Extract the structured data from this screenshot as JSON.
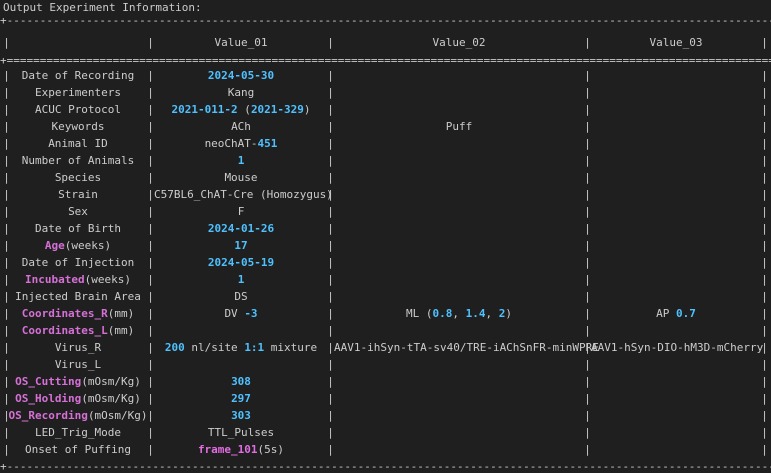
{
  "title": "Output Experiment Information:",
  "border_char": "-",
  "header": {
    "col0": "",
    "col1": "Value_01",
    "col2": "Value_02",
    "col3": "Value_03"
  },
  "colors": {
    "number": "#4fc1ff",
    "highlight": "#d670d6",
    "text": "#cccccc",
    "background": "#1f1f1f"
  },
  "rows": [
    {
      "label": [
        {
          "t": "Date of Recording"
        }
      ],
      "v1": [
        {
          "t": "2024-05-30",
          "c": "num"
        }
      ],
      "v2": [],
      "v3": []
    },
    {
      "label": [
        {
          "t": "Experimenters"
        }
      ],
      "v1": [
        {
          "t": "Kang"
        }
      ],
      "v2": [],
      "v3": []
    },
    {
      "label": [
        {
          "t": "ACUC Protocol"
        }
      ],
      "v1": [
        {
          "t": "2021-011-2",
          "c": "num"
        },
        {
          "t": " ("
        },
        {
          "t": "2021-329",
          "c": "num"
        },
        {
          "t": ")"
        }
      ],
      "v2": [],
      "v3": []
    },
    {
      "label": [
        {
          "t": "Keywords"
        }
      ],
      "v1": [
        {
          "t": "ACh"
        }
      ],
      "v2": [
        {
          "t": "Puff"
        }
      ],
      "v3": []
    },
    {
      "label": [
        {
          "t": "Animal ID"
        }
      ],
      "v1": [
        {
          "t": "neoChAT-"
        },
        {
          "t": "451",
          "c": "num"
        }
      ],
      "v2": [],
      "v3": []
    },
    {
      "label": [
        {
          "t": "Number of Animals"
        }
      ],
      "v1": [
        {
          "t": "1",
          "c": "num"
        }
      ],
      "v2": [],
      "v3": []
    },
    {
      "label": [
        {
          "t": "Species"
        }
      ],
      "v1": [
        {
          "t": "Mouse"
        }
      ],
      "v2": [],
      "v3": []
    },
    {
      "label": [
        {
          "t": "Strain"
        }
      ],
      "v1": [
        {
          "t": "C57BL6_ChAT-Cre (Homozygus)"
        }
      ],
      "v2": [],
      "v3": []
    },
    {
      "label": [
        {
          "t": "Sex"
        }
      ],
      "v1": [
        {
          "t": "F"
        }
      ],
      "v2": [],
      "v3": []
    },
    {
      "label": [
        {
          "t": "Date of Birth"
        }
      ],
      "v1": [
        {
          "t": "2024-01-26",
          "c": "num"
        }
      ],
      "v2": [],
      "v3": []
    },
    {
      "label": [
        {
          "t": "Age",
          "c": "mag"
        },
        {
          "t": "(weeks)"
        }
      ],
      "v1": [
        {
          "t": "17",
          "c": "num"
        }
      ],
      "v2": [],
      "v3": []
    },
    {
      "label": [
        {
          "t": "Date of Injection"
        }
      ],
      "v1": [
        {
          "t": "2024-05-19",
          "c": "num"
        }
      ],
      "v2": [],
      "v3": []
    },
    {
      "label": [
        {
          "t": "Incubated",
          "c": "mag"
        },
        {
          "t": "(weeks)"
        }
      ],
      "v1": [
        {
          "t": "1",
          "c": "num"
        }
      ],
      "v2": [],
      "v3": []
    },
    {
      "label": [
        {
          "t": "Injected Brain Area"
        }
      ],
      "v1": [
        {
          "t": "DS"
        }
      ],
      "v2": [],
      "v3": []
    },
    {
      "label": [
        {
          "t": "Coordinates_R",
          "c": "mag"
        },
        {
          "t": "(mm)"
        }
      ],
      "v1": [
        {
          "t": "DV "
        },
        {
          "t": "-3",
          "c": "num"
        }
      ],
      "v2": [
        {
          "t": "ML ("
        },
        {
          "t": "0.8",
          "c": "num"
        },
        {
          "t": ", "
        },
        {
          "t": "1.4",
          "c": "num"
        },
        {
          "t": ", "
        },
        {
          "t": "2",
          "c": "num"
        },
        {
          "t": ")"
        }
      ],
      "v3": [
        {
          "t": "AP "
        },
        {
          "t": "0.7",
          "c": "num"
        }
      ]
    },
    {
      "label": [
        {
          "t": "Coordinates_L",
          "c": "mag"
        },
        {
          "t": "(mm)"
        }
      ],
      "v1": [],
      "v2": [],
      "v3": []
    },
    {
      "label": [
        {
          "t": "Virus_R"
        }
      ],
      "v1": [
        {
          "t": "200",
          "c": "num"
        },
        {
          "t": " nl/site "
        },
        {
          "t": "1:1",
          "c": "num"
        },
        {
          "t": " mixture"
        }
      ],
      "v2": [
        {
          "t": "AAV1-ihSyn-tTA-sv40/TRE-iAChSnFR-minWPRE"
        }
      ],
      "v3": [
        {
          "t": "AAV1-hSyn-DIO-hM3D-mCherry"
        }
      ]
    },
    {
      "label": [
        {
          "t": "Virus_L"
        }
      ],
      "v1": [],
      "v2": [],
      "v3": []
    },
    {
      "label": [
        {
          "t": "OS_Cutting",
          "c": "mag"
        },
        {
          "t": "(mOsm/Kg)"
        }
      ],
      "v1": [
        {
          "t": "308",
          "c": "num"
        }
      ],
      "v2": [],
      "v3": []
    },
    {
      "label": [
        {
          "t": "OS_Holding",
          "c": "mag"
        },
        {
          "t": "(mOsm/Kg)"
        }
      ],
      "v1": [
        {
          "t": "297",
          "c": "num"
        }
      ],
      "v2": [],
      "v3": []
    },
    {
      "label": [
        {
          "t": "OS_Recording",
          "c": "mag"
        },
        {
          "t": "(mOsm/Kg)"
        }
      ],
      "v1": [
        {
          "t": "303",
          "c": "num"
        }
      ],
      "v2": [],
      "v3": []
    },
    {
      "label": [
        {
          "t": "LED_Trig_Mode"
        }
      ],
      "v1": [
        {
          "t": "TTL_Pulses"
        }
      ],
      "v2": [],
      "v3": []
    },
    {
      "label": [
        {
          "t": "Onset of Puffing"
        }
      ],
      "v1": [
        {
          "t": "frame_101",
          "c": "mag2"
        },
        {
          "t": "(5s)"
        }
      ],
      "v2": [],
      "v3": []
    }
  ]
}
